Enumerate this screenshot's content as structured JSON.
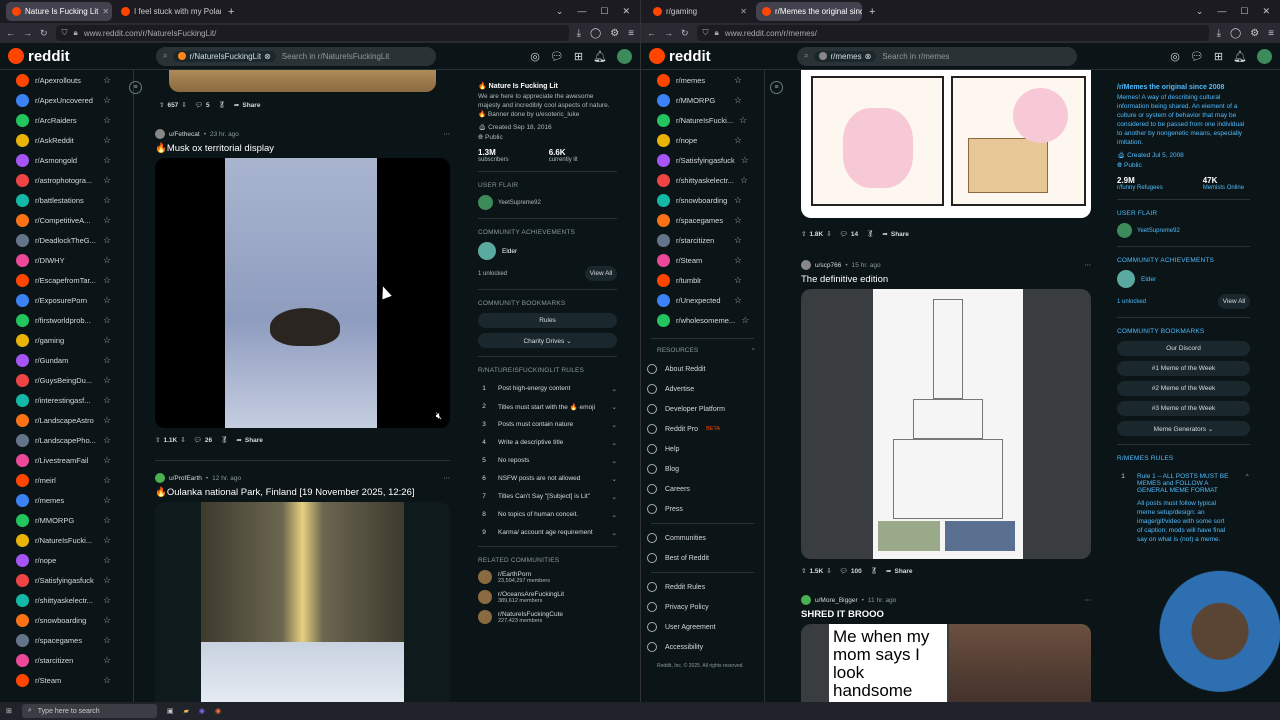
{
  "left": {
    "tabs": [
      {
        "label": "Nature Is Fucking Lit"
      },
      {
        "label": "I feel stuck with my Polaris..."
      }
    ],
    "url": "www.reddit.com/r/NatureIsFuckingLit/",
    "search_chip": "r/NatureIsFuckingLit",
    "search_placeholder": "Search in r/NatureIsFuckingLit",
    "sidebar": [
      "r/Apexrollouts",
      "r/ApexUncovered",
      "r/ArcRaiders",
      "r/AskReddit",
      "r/Asmongold",
      "r/astrophotogra...",
      "r/battlestations",
      "r/CompetitiveA...",
      "r/DeadlockTheG...",
      "r/DIWHY",
      "r/EscapefromTar...",
      "r/ExposurePorn",
      "r/firstworldprob...",
      "r/gaming",
      "r/Gundam",
      "r/GuysBeingDu...",
      "r/interestingasf...",
      "r/LandscapeAstro",
      "r/LandscapePho...",
      "r/LivestreamFail",
      "r/meirl",
      "r/memes",
      "r/MMORPG",
      "r/NatureIsFucki...",
      "r/nope",
      "r/Satisfyingasfuck",
      "r/shittyaskelectr...",
      "r/snowboarding",
      "r/spacegames",
      "r/starcitizen",
      "r/Steam"
    ],
    "top_actions": {
      "votes": "657",
      "comments": "5",
      "share": "Share"
    },
    "post1": {
      "user": "u/Fethecat",
      "time": "23 hr. ago",
      "title": "🔥Musk ox territorial display",
      "votes": "1.1K",
      "comments": "26",
      "share": "Share"
    },
    "post2": {
      "user": "u/ProfEarth",
      "time": "12 hr. ago",
      "title": "🔥Oulanka national Park, Finland [19 November 2025, 12:26]"
    },
    "about": {
      "name": "🔥 Nature Is Fucking Lit",
      "desc": "We are here to appreciate the awesome majesty and incredibly cool aspects of nature. 🔥 Banner done by u/esoteric_luke",
      "created": "Created Sep 18, 2016",
      "visibility": "Public",
      "members": "1.3M",
      "members_label": "subscribers",
      "online": "6.6K",
      "online_label": "currently lit"
    },
    "user_flair_hd": "USER FLAIR",
    "user_flair": "YeetSupreme92",
    "ach_hd": "COMMUNITY ACHIEVEMENTS",
    "ach": "Elder",
    "ach_unlocked": "1 unlocked",
    "view_all": "View All",
    "bookmarks_hd": "COMMUNITY BOOKMARKS",
    "bookmarks": [
      "Rules",
      "Charity Drives ⌄"
    ],
    "rules_hd": "R/NATUREISFUCKINGLIT RULES",
    "rules": [
      "Post high-energy content",
      "Titles must start with the 🔥 emoji",
      "Posts must contain nature",
      "Write a descriptive title",
      "No reposts",
      "NSFW posts are not allowed",
      "Titles Can't Say \"[Subject] is Lit\"",
      "No topics of human conceit.",
      "Karma/ account age requirement"
    ],
    "related_hd": "RELATED COMMUNITIES",
    "related": [
      {
        "name": "r/EarthPorn",
        "members": "23,594,297 members"
      },
      {
        "name": "r/OceansAreFuckingLit",
        "members": "389,612 members"
      },
      {
        "name": "r/NatureIsFuckingCute",
        "members": "227,423 members"
      }
    ]
  },
  "right": {
    "tabs": [
      {
        "label": "r/gaming"
      },
      {
        "label": "r/Memes the original since 20..."
      }
    ],
    "url": "www.reddit.com/r/memes/",
    "search_chip": "r/memes",
    "search_placeholder": "Search in r/memes",
    "sidebar": [
      "r/memes",
      "r/MMORPG",
      "r/NatureIsFucki...",
      "r/nope",
      "r/Satisfyingasfuck",
      "r/shittyaskelectr...",
      "r/snowboarding",
      "r/spacegames",
      "r/starcitizen",
      "r/Steam",
      "r/tumblr",
      "r/Unexpected",
      "r/wholesomeme..."
    ],
    "resources_hd": "RESOURCES",
    "resources": [
      "About Reddit",
      "Advertise",
      "Developer Platform",
      "Reddit Pro",
      "Help",
      "Blog",
      "Careers",
      "Press"
    ],
    "beta": "BETA",
    "resources2": [
      "Communities",
      "Best of Reddit"
    ],
    "resources3": [
      "Reddit Rules",
      "Privacy Policy",
      "User Agreement",
      "Accessibility"
    ],
    "copyright": "Reddit, Inc. © 2025. All rights reserved.",
    "top_actions": {
      "votes": "1.8K",
      "comments": "14",
      "share": "Share"
    },
    "post1": {
      "user": "u/scp766",
      "time": "15 hr. ago",
      "title": "The definitive edition",
      "votes": "1.5K",
      "comments": "100",
      "share": "Share"
    },
    "post2": {
      "user": "u/More_Bigger",
      "time": "11 hr. ago",
      "title": "SHRED IT BROOO",
      "meme_text": "Me when my mom says I look handsome"
    },
    "about": {
      "name": "/r/Memes the original since 2008",
      "desc": "Memes! A way of describing cultural information being shared. An element of a culture or system of behavior that may be considered to be passed from one individual to another by nongenetic means, especially imitation.",
      "created": "Created Jul 5, 2008",
      "visibility": "Public",
      "members": "2.9M",
      "members_label": "r/funny Refugees",
      "online": "47K",
      "online_label": "Memists Online"
    },
    "user_flair_hd": "USER FLAIR",
    "user_flair": "YeetSupreme92",
    "ach_hd": "COMMUNITY ACHIEVEMENTS",
    "ach": "Elder",
    "ach_unlocked": "1 unlocked",
    "view_all": "View All",
    "bookmarks_hd": "COMMUNITY BOOKMARKS",
    "bookmarks": [
      "Our Discord",
      "#1 Meme of the Week",
      "#2 Meme of the Week",
      "#3 Meme of the Week",
      "Meme Generators ⌄"
    ],
    "rules_hd": "R/MEMES RULES",
    "rule1": "Rule 1 – ALL POSTS MUST BE MEMES and FOLLOW A GENERAL MEME FORMAT",
    "rule1_desc": "All posts must follow typical meme setup/design: an image/gif/video with some sort of caption; mods will have final say on what is (not) a meme."
  },
  "taskbar": {
    "search": "Type here to search"
  },
  "colors": {
    "bg": "#0b1416",
    "accent": "#ff4500"
  }
}
